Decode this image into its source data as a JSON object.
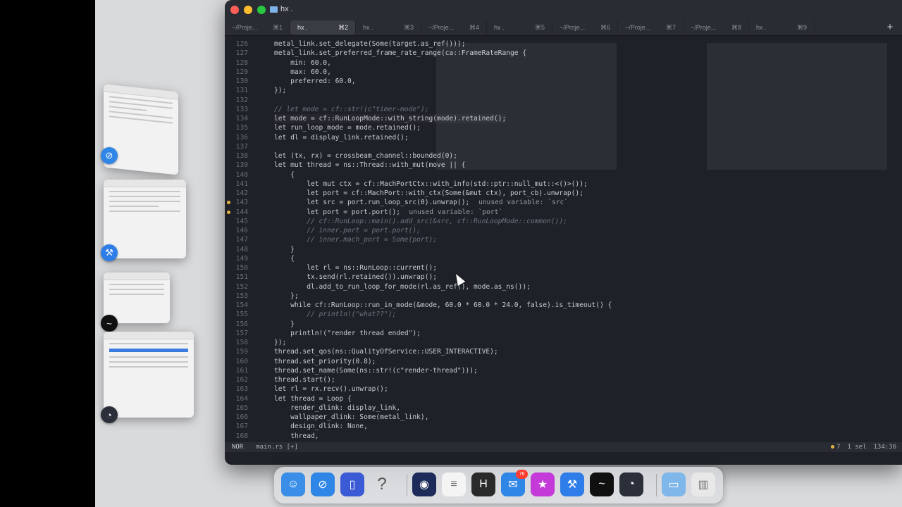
{
  "window": {
    "title": "hx .",
    "tabs": [
      {
        "label": "~/Proje...",
        "shortcut": "⌘1"
      },
      {
        "label": "hx .",
        "shortcut": "⌘2",
        "active": true
      },
      {
        "label": "hx .",
        "shortcut": "⌘3"
      },
      {
        "label": "~/Proje...",
        "shortcut": "⌘4"
      },
      {
        "label": "hx .",
        "shortcut": "⌘5"
      },
      {
        "label": "~/Proje...",
        "shortcut": "⌘6"
      },
      {
        "label": "~/Proje...",
        "shortcut": "⌘7"
      },
      {
        "label": "~/Proje...",
        "shortcut": "⌘8"
      },
      {
        "label": "hx .",
        "shortcut": "⌘9"
      }
    ],
    "add_tab_label": "+"
  },
  "editor": {
    "lines": [
      {
        "n": "126",
        "text": "metal_link.set_delegate(Some(target.as_ref()));"
      },
      {
        "n": "127",
        "text": "metal_link.set_preferred_frame_rate_range(ca::FrameRateRange {"
      },
      {
        "n": "128",
        "text": "    min: 60.0,"
      },
      {
        "n": "129",
        "text": "    max: 60.0,"
      },
      {
        "n": "130",
        "text": "    preferred: 60.0,"
      },
      {
        "n": "131",
        "text": "});"
      },
      {
        "n": "132",
        "text": ""
      },
      {
        "n": "133",
        "text": "// let mode = cf::str!(c\"timer-mode\");",
        "comment": true
      },
      {
        "n": "134",
        "text": "let mode = cf::RunLoopMode::with_string(mode).retained();",
        "cursor": true
      },
      {
        "n": "135",
        "text": "let run_loop_mode = mode.retained();"
      },
      {
        "n": "136",
        "text": "let dl = display_link.retained();"
      },
      {
        "n": "137",
        "text": ""
      },
      {
        "n": "138",
        "text": "let (tx, rx) = crossbeam_channel::bounded(0);"
      },
      {
        "n": "139",
        "text": "let mut thread = ns::Thread::with_mut(move || {"
      },
      {
        "n": "140",
        "text": "    {"
      },
      {
        "n": "141",
        "text": "        let mut ctx = cf::MachPortCtx::with_info(std::ptr::null_mut::<()>());"
      },
      {
        "n": "142",
        "text": "        let port = cf::MachPort::with_ctx(Some(&mut ctx), port_cb).unwrap();"
      },
      {
        "n": "143",
        "text": "        let src = port.run_loop_src(0).unwrap();",
        "diag": "unused variable: `src`",
        "warn": true
      },
      {
        "n": "144",
        "text": "        let port = port.port();",
        "diag": "unused variable: `port`",
        "warn": true
      },
      {
        "n": "145",
        "text": "        // cf::RunLoop::main().add_src(&src, cf::RunLoopMode::common());",
        "comment": true
      },
      {
        "n": "146",
        "text": "        // inner.port = port.port();",
        "comment": true
      },
      {
        "n": "147",
        "text": "        // inner.mach_port = Some(port);",
        "comment": true
      },
      {
        "n": "148",
        "text": "    }"
      },
      {
        "n": "149",
        "text": "    {"
      },
      {
        "n": "150",
        "text": "        let rl = ns::RunLoop::current();"
      },
      {
        "n": "151",
        "text": "        tx.send(rl.retained()).unwrap();"
      },
      {
        "n": "152",
        "text": "        dl.add_to_run_loop_for_mode(rl.as_ref(), mode.as_ns());"
      },
      {
        "n": "153",
        "text": "    };"
      },
      {
        "n": "154",
        "text": "    while cf::RunLoop::run_in_mode(&mode, 60.0 * 60.0 * 24.0, false).is_timeout() {"
      },
      {
        "n": "155",
        "text": "        // println!(\"what??\");",
        "comment": true
      },
      {
        "n": "156",
        "text": "    }"
      },
      {
        "n": "157",
        "text": "    println!(\"render thread ended\");"
      },
      {
        "n": "158",
        "text": "});"
      },
      {
        "n": "159",
        "text": "thread.set_qos(ns::QualityOfService::USER_INTERACTIVE);"
      },
      {
        "n": "160",
        "text": "thread.set_priority(0.8);"
      },
      {
        "n": "161",
        "text": "thread.set_name(Some(ns::str!(c\"render-thread\")));"
      },
      {
        "n": "162",
        "text": "thread.start();"
      },
      {
        "n": "163",
        "text": "let rl = rx.recv().unwrap();"
      },
      {
        "n": "164",
        "text": "let thread = Loop {"
      },
      {
        "n": "165",
        "text": "    render_dlink: display_link,"
      },
      {
        "n": "166",
        "text": "    wallpaper_dlink: Some(metal_link),"
      },
      {
        "n": "167",
        "text": "    design_dlink: None,"
      },
      {
        "n": "168",
        "text": "    thread,"
      }
    ]
  },
  "statusline": {
    "mode": "NOR",
    "file": "main.rs [+]",
    "warnings": "7",
    "selection": "1 sel",
    "position": "134:36"
  },
  "dock": {
    "mail_badge": "76",
    "items": [
      {
        "name": "finder",
        "color": "#3a8ee8",
        "glyph": "☺"
      },
      {
        "name": "safari",
        "color": "#2f86e6",
        "glyph": "⊘"
      },
      {
        "name": "app-store-like",
        "color": "#3b5bd6",
        "glyph": "▯"
      },
      {
        "name": "help",
        "color": "transparent",
        "glyph": "?"
      },
      {
        "name": "chat",
        "color": "#1c2b5a",
        "glyph": "◉"
      },
      {
        "name": "notes",
        "color": "#f4f4f4",
        "glyph": "≡"
      },
      {
        "name": "helix",
        "color": "#2a2a2a",
        "glyph": "H"
      },
      {
        "name": "mail",
        "color": "#2f86e6",
        "glyph": "✉"
      },
      {
        "name": "star-app",
        "color": "#c33ad8",
        "glyph": "★"
      },
      {
        "name": "xcode-beta",
        "color": "#2f7de8",
        "glyph": "⚒"
      },
      {
        "name": "activity-monitor",
        "color": "#101010",
        "glyph": "~"
      },
      {
        "name": "instruments",
        "color": "#2b2f3a",
        "glyph": "◔"
      },
      {
        "name": "downloads-folder",
        "color": "#7fb7ea",
        "glyph": "▭"
      },
      {
        "name": "trash",
        "color": "#e8e8e8",
        "glyph": "▥"
      }
    ]
  }
}
